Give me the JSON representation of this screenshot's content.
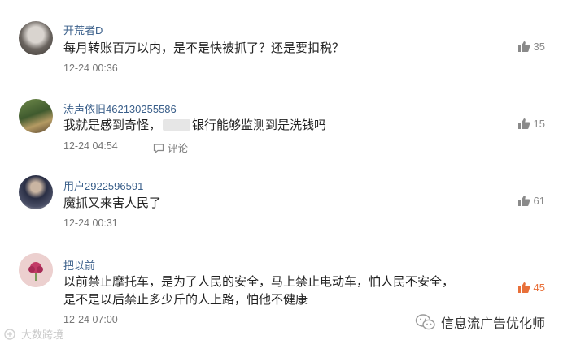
{
  "comments": [
    {
      "username": "开荒者D",
      "text_lines": [
        "每月转账百万以内，是不是快被抓了？还是要扣税？"
      ],
      "time": "12-24 00:36",
      "likes": "35",
      "reply_label": ""
    },
    {
      "username": "涛声依旧462130255586",
      "text_before": "我就是感到奇怪，",
      "text_after": "银行能够监测到是洗钱吗",
      "time": "12-24 04:54",
      "likes": "15",
      "reply_label": "评论"
    },
    {
      "username": "用户2922596591",
      "text_lines": [
        "魔抓又来害人民了"
      ],
      "time": "12-24 00:31",
      "likes": "61",
      "reply_label": ""
    },
    {
      "username": "把以前",
      "text_lines": [
        "以前禁止摩托车，是为了人民的安全，马上禁止电动车，怕人民不安全，",
        "是不是以后禁止多少斤的人上路，怕他不健康"
      ],
      "time": "12-24 07:00",
      "likes": "45",
      "reply_label": ""
    }
  ],
  "watermark": {
    "left_text": "大数跨境",
    "right_text": "信息流广告优化师"
  },
  "colors": {
    "username": "#3a5f8a",
    "like_active": "#e8703a",
    "like_default": "#8a8a8a"
  }
}
